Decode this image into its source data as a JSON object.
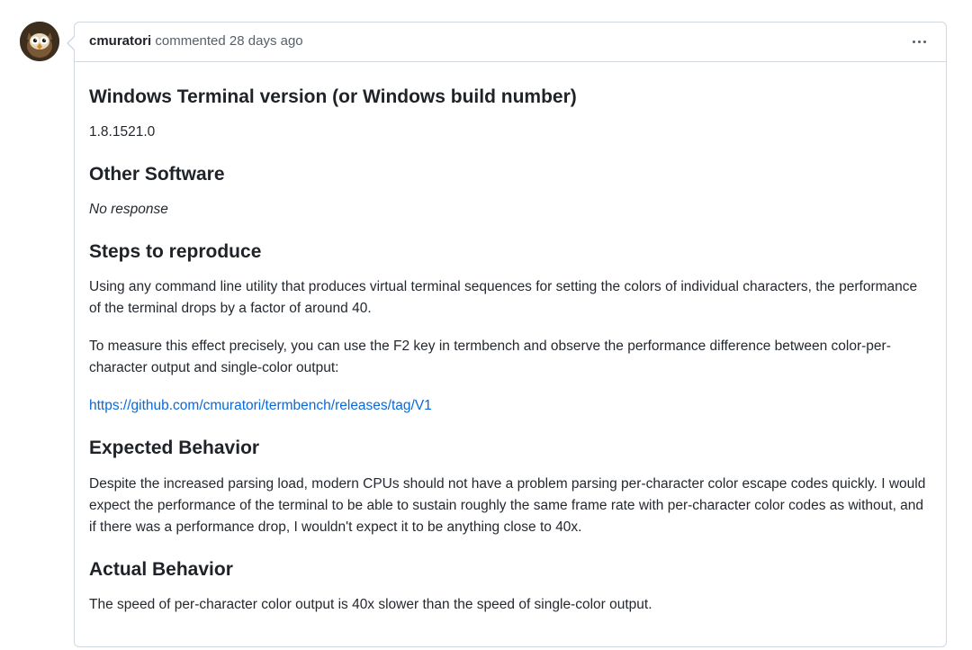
{
  "comment": {
    "author": "cmuratori",
    "verb": "commented",
    "timestamp": "28 days ago",
    "sections": {
      "version": {
        "heading": "Windows Terminal version (or Windows build number)",
        "value": "1.8.1521.0"
      },
      "other_software": {
        "heading": "Other Software",
        "no_response": "No response"
      },
      "steps": {
        "heading": "Steps to reproduce",
        "p1": "Using any command line utility that produces virtual terminal sequences for setting the colors of individual characters, the performance of the terminal drops by a factor of around 40.",
        "p2": "To measure this effect precisely, you can use the F2 key in termbench and observe the performance difference between color-per-character output and single-color output:",
        "link_text": "https://github.com/cmuratori/termbench/releases/tag/V1"
      },
      "expected": {
        "heading": "Expected Behavior",
        "p1": "Despite the increased parsing load, modern CPUs should not have a problem parsing per-character color escape codes quickly. I would expect the performance of the terminal to be able to sustain roughly the same frame rate with per-character color codes as without, and if there was a performance drop, I wouldn't expect it to be anything close to 40x."
      },
      "actual": {
        "heading": "Actual Behavior",
        "p1": "The speed of per-character color output is 40x slower than the speed of single-color output."
      }
    }
  }
}
